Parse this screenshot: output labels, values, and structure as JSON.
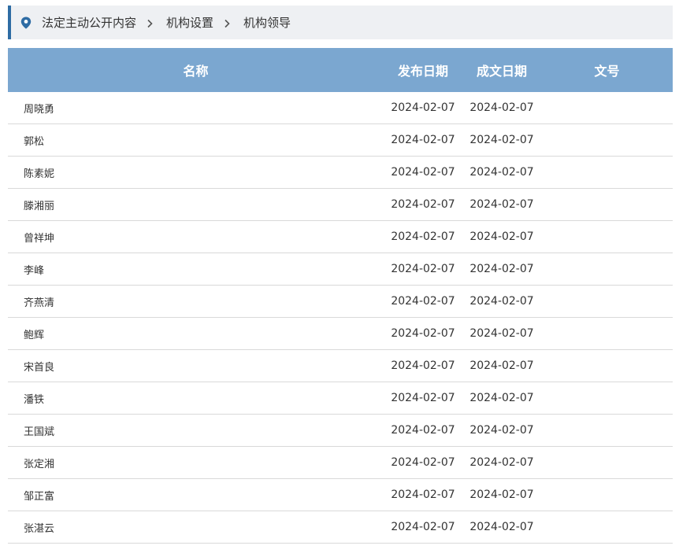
{
  "breadcrumb": {
    "icon": "location-pin-icon",
    "items": [
      "法定主动公开内容",
      "机构设置",
      "机构领导"
    ]
  },
  "colors": {
    "accent": "#2e6ca4",
    "header_bg": "#7ba7d0",
    "breadcrumb_bg": "#eef0f3"
  },
  "table": {
    "headers": {
      "name": "名称",
      "publish_date": "发布日期",
      "created_date": "成文日期",
      "doc_number": "文号"
    },
    "rows": [
      {
        "name": "周晓勇",
        "publish_date": "2024-02-07",
        "created_date": "2024-02-07",
        "doc_number": ""
      },
      {
        "name": "郭松",
        "publish_date": "2024-02-07",
        "created_date": "2024-02-07",
        "doc_number": ""
      },
      {
        "name": "陈素妮",
        "publish_date": "2024-02-07",
        "created_date": "2024-02-07",
        "doc_number": ""
      },
      {
        "name": "滕湘丽",
        "publish_date": "2024-02-07",
        "created_date": "2024-02-07",
        "doc_number": ""
      },
      {
        "name": "曾祥坤",
        "publish_date": "2024-02-07",
        "created_date": "2024-02-07",
        "doc_number": ""
      },
      {
        "name": "李峰",
        "publish_date": "2024-02-07",
        "created_date": "2024-02-07",
        "doc_number": ""
      },
      {
        "name": "齐燕清",
        "publish_date": "2024-02-07",
        "created_date": "2024-02-07",
        "doc_number": ""
      },
      {
        "name": "鲍辉",
        "publish_date": "2024-02-07",
        "created_date": "2024-02-07",
        "doc_number": ""
      },
      {
        "name": "宋首良",
        "publish_date": "2024-02-07",
        "created_date": "2024-02-07",
        "doc_number": ""
      },
      {
        "name": "潘铁",
        "publish_date": "2024-02-07",
        "created_date": "2024-02-07",
        "doc_number": ""
      },
      {
        "name": "王国斌",
        "publish_date": "2024-02-07",
        "created_date": "2024-02-07",
        "doc_number": ""
      },
      {
        "name": "张定湘",
        "publish_date": "2024-02-07",
        "created_date": "2024-02-07",
        "doc_number": ""
      },
      {
        "name": "邹正富",
        "publish_date": "2024-02-07",
        "created_date": "2024-02-07",
        "doc_number": ""
      },
      {
        "name": "张湛云",
        "publish_date": "2024-02-07",
        "created_date": "2024-02-07",
        "doc_number": ""
      }
    ]
  }
}
